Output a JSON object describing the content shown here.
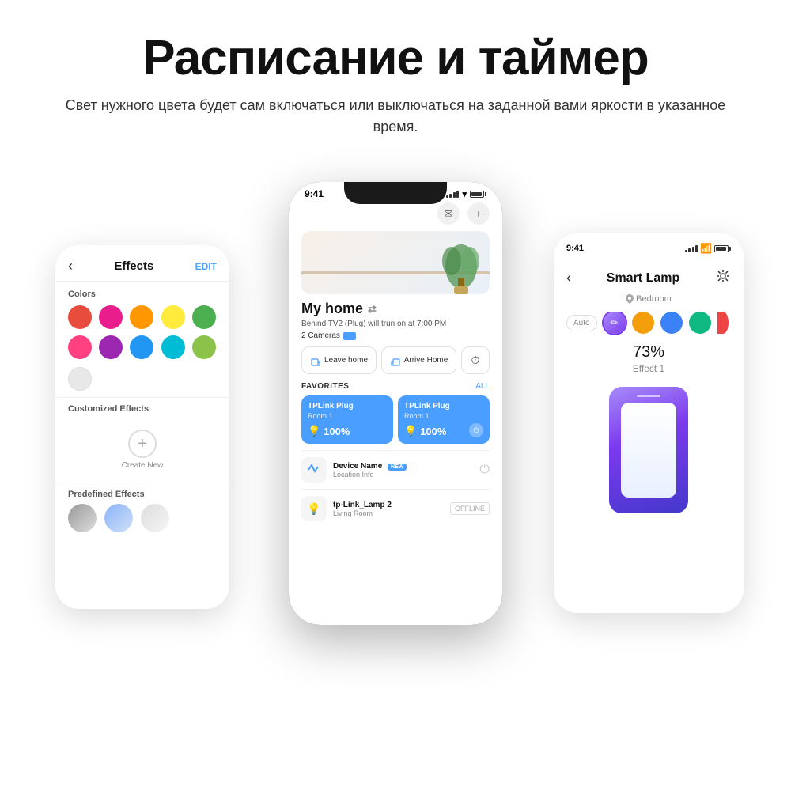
{
  "header": {
    "title": "Расписание и таймер",
    "subtitle": "Свет нужного цвета будет сам включаться или выключаться на заданной вами яркости в указанное время."
  },
  "left_phone": {
    "back_label": "‹",
    "title": "Effects",
    "edit_label": "EDIT",
    "colors_title": "Colors",
    "colors": [
      {
        "color": "#e74c3c",
        "name": "red"
      },
      {
        "color": "#e91e8c",
        "name": "pink"
      },
      {
        "color": "#ff9800",
        "name": "orange"
      },
      {
        "color": "#ffeb3b",
        "name": "yellow"
      },
      {
        "color": "#4caf50",
        "name": "green"
      },
      {
        "color": "#ff4081",
        "name": "hot-pink"
      },
      {
        "color": "#9c27b0",
        "name": "purple"
      },
      {
        "color": "#2196f3",
        "name": "blue"
      },
      {
        "color": "#00bcd4",
        "name": "cyan"
      },
      {
        "color": "#8bc34a",
        "name": "light-green"
      }
    ],
    "white_dot_color": "#e0e0e0",
    "customized_title": "Customized Effects",
    "create_new_label": "Create New",
    "predefined_title": "Predefined Effects",
    "predefined_effects": [
      {
        "color": "linear-gradient(135deg, #aaa, #eee)",
        "name": "effect-1"
      },
      {
        "color": "linear-gradient(135deg, #8ab4f8, #c8d8f8)",
        "name": "effect-2"
      },
      {
        "color": "linear-gradient(135deg, #ddd, #f5f5f5)",
        "name": "effect-3"
      }
    ]
  },
  "center_phone": {
    "time": "9:41",
    "home_title": "My home",
    "plug_notice": "Behind TV2 (Plug) will trun on at 7:00 PM",
    "cameras_label": "2 Cameras",
    "action_buttons": [
      {
        "label": "Leave home",
        "icon": "door-exit"
      },
      {
        "label": "Arrive Home",
        "icon": "door-enter"
      }
    ],
    "favorites_title": "FAVORITES",
    "favorites_all": "ALL",
    "fav_cards": [
      {
        "title": "TPLink Plug",
        "room": "Room 1",
        "percent": "100%"
      },
      {
        "title": "TPLink Plug",
        "room": "Room 1",
        "percent": "100%"
      }
    ],
    "device_items": [
      {
        "name": "Device Name",
        "location": "Location Info",
        "badge": "NEW"
      },
      {
        "name": "tp-Link_Lamp 2",
        "location": "Living Room",
        "status": "OFFLINE"
      }
    ],
    "bottom_items": [
      {
        "name": "Device Name"
      },
      {
        "name": "tp-Link_Lamp 2"
      }
    ]
  },
  "right_phone": {
    "time": "9:41",
    "back_label": "‹",
    "title": "Smart Lamp",
    "settings_icon": "⚙",
    "location": "Bedroom",
    "auto_label": "Auto",
    "colors": [
      {
        "color": "linear-gradient(135deg, #a78bfa, #7c3aed)",
        "name": "purple-gradient",
        "selected": true
      },
      {
        "color": "#f59e0b",
        "name": "amber"
      },
      {
        "color": "#3b82f6",
        "name": "blue"
      },
      {
        "color": "#10b981",
        "name": "teal"
      },
      {
        "color": "#ef4444",
        "name": "red-partial"
      }
    ],
    "percent": "73%",
    "effect_label": "Effect 1"
  }
}
